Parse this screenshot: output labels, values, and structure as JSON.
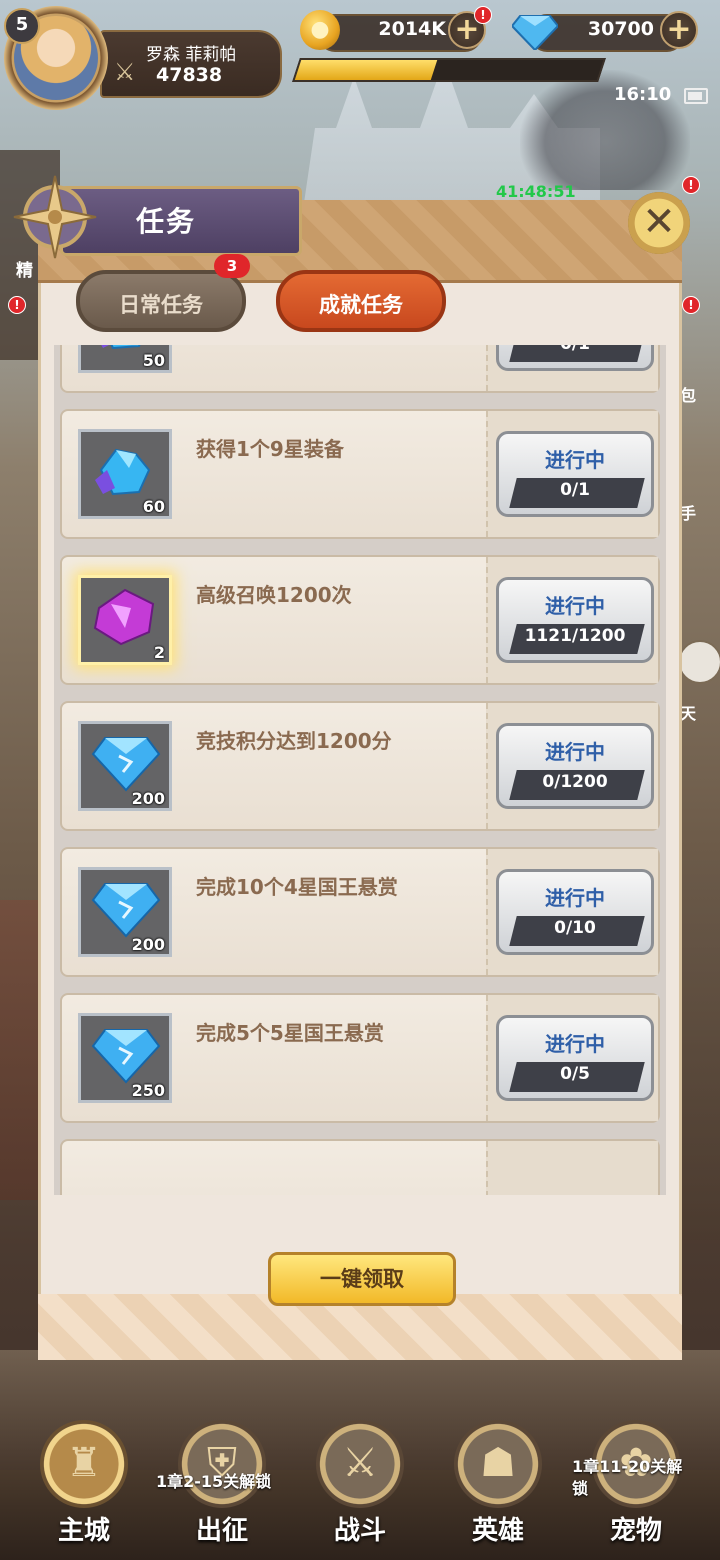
{
  "hud": {
    "level": "5",
    "player_name": "罗森 菲莉帕",
    "power": "47838",
    "coins": "2014K",
    "gems": "30700",
    "coin_alert": "!",
    "exp_progress": 0.45,
    "clock": "16:10",
    "event_timer": "41:48:51"
  },
  "side": {
    "left_label": "精",
    "right_label_1": "包",
    "right_label_2": "手",
    "right_label_3": "天",
    "alert": "!"
  },
  "dialog": {
    "title": "任务",
    "close_icon": "close-icon",
    "tabs": [
      {
        "label": "日常任务",
        "badge": "3",
        "active": false
      },
      {
        "label": "成就任务",
        "active": true
      }
    ],
    "tasks": [
      {
        "title": "",
        "reward_icon": "crystal-icon",
        "reward_count": "50",
        "status": "",
        "progress": "0/1"
      },
      {
        "title": "获得1个9星装备",
        "reward_icon": "crystal-icon",
        "reward_count": "60",
        "status": "进行中",
        "progress": "0/1"
      },
      {
        "title": "高级召唤1200次",
        "reward_icon": "purple-shard-icon",
        "reward_count": "2",
        "status": "进行中",
        "progress": "1121/1200"
      },
      {
        "title": "竞技积分达到1200分",
        "reward_icon": "diamond-icon",
        "reward_count": "200",
        "status": "进行中",
        "progress": "0/1200"
      },
      {
        "title": "完成10个4星国王悬赏",
        "reward_icon": "diamond-icon",
        "reward_count": "200",
        "status": "进行中",
        "progress": "0/10"
      },
      {
        "title": "完成5个5星国王悬赏",
        "reward_icon": "diamond-icon",
        "reward_count": "250",
        "status": "进行中",
        "progress": "0/5"
      }
    ],
    "claim_all": "一键领取"
  },
  "nav": {
    "items": [
      {
        "label": "主城",
        "icon": "castle-icon"
      },
      {
        "label": "出征",
        "icon": "shield-icon"
      },
      {
        "label": "战斗",
        "icon": "crossed-swords-icon"
      },
      {
        "label": "英雄",
        "icon": "hood-icon"
      },
      {
        "label": "宠物",
        "icon": "pet-icon"
      }
    ],
    "lock_note_1": "1章2-15关解锁",
    "lock_note_2": "1章11-20关解锁"
  },
  "colors": {
    "accent_orange": "#d85a27",
    "status_blue": "#2f5fa8",
    "task_title": "#8a6a50",
    "timer_green": "#22c84a"
  }
}
